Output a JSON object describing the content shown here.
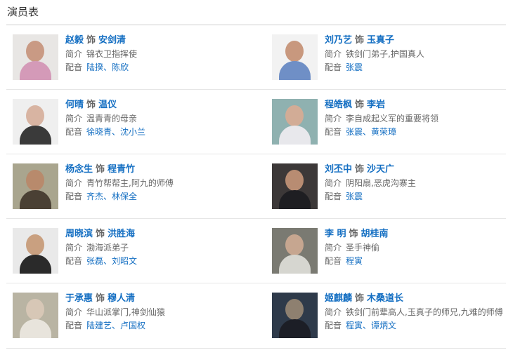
{
  "page": {
    "title": "演员表"
  },
  "labels": {
    "shi": "饰",
    "intro": "简介",
    "dub": "配音"
  },
  "cast": [
    {
      "actor": "赵毅",
      "role": "安剑清",
      "intro": "锦衣卫指挥使",
      "dub": "陆揆、陈欣",
      "colors": {
        "bg": "#e8e6e4",
        "skin": "#c99a84",
        "cloth": "#d49ab8"
      }
    },
    {
      "actor": "刘乃艺",
      "role": "玉真子",
      "intro": "铁剑门弟子,护国真人",
      "dub": "张震",
      "colors": {
        "bg": "#f2f2f2",
        "skin": "#c8987e",
        "cloth": "#6f8fc6"
      }
    },
    {
      "actor": "何晴",
      "role": "温仪",
      "intro": "温青青的母亲",
      "dub": "徐晓青、沈小兰",
      "colors": {
        "bg": "#efefef",
        "skin": "#d8b4a2",
        "cloth": "#3a3a3a"
      }
    },
    {
      "actor": "程皓枫",
      "role": "李岩",
      "intro": "李自成起义军的重要将领",
      "dub": "张震、黄荣璋",
      "colors": {
        "bg": "#8fb1b0",
        "skin": "#d2ac96",
        "cloth": "#e8e8ec"
      }
    },
    {
      "actor": "杨念生",
      "role": "程青竹",
      "intro": "青竹帮帮主,阿九的师傅",
      "dub": "齐杰、林保全",
      "colors": {
        "bg": "#a9a58e",
        "skin": "#b88a6c",
        "cloth": "#4a4034"
      }
    },
    {
      "actor": "刘丕中",
      "role": "沙天广",
      "intro": "阴阳扇,恶虎沟寨主",
      "dub": "张震",
      "colors": {
        "bg": "#3c3838",
        "skin": "#b88c72",
        "cloth": "#1e1e22"
      }
    },
    {
      "actor": "周晓滨",
      "role": "洪胜海",
      "intro": "渤海派弟子",
      "dub": "张磊、刘昭文",
      "colors": {
        "bg": "#e9e9e9",
        "skin": "#c9a080",
        "cloth": "#2a2a2a"
      }
    },
    {
      "actor": "李 明",
      "role": "胡桂南",
      "intro": "圣手神偷",
      "dub": "程寅",
      "colors": {
        "bg": "#7a7a72",
        "skin": "#c6a690",
        "cloth": "#d6d6d0"
      }
    },
    {
      "actor": "于承惠",
      "role": "穆人清",
      "intro": "华山派掌门,神剑仙猿",
      "dub": "陆建艺、卢国权",
      "colors": {
        "bg": "#b9b4a3",
        "skin": "#d7c7b6",
        "cloth": "#e8e4dc"
      }
    },
    {
      "actor": "姬麒麟",
      "role": "木桑道长",
      "intro": "铁剑门前辈高人,玉真子的师兄,九难的师傅",
      "dub": "程寅、谭炳文",
      "colors": {
        "bg": "#2e3a4a",
        "skin": "#8e8070",
        "cloth": "#1c1e26"
      }
    }
  ]
}
